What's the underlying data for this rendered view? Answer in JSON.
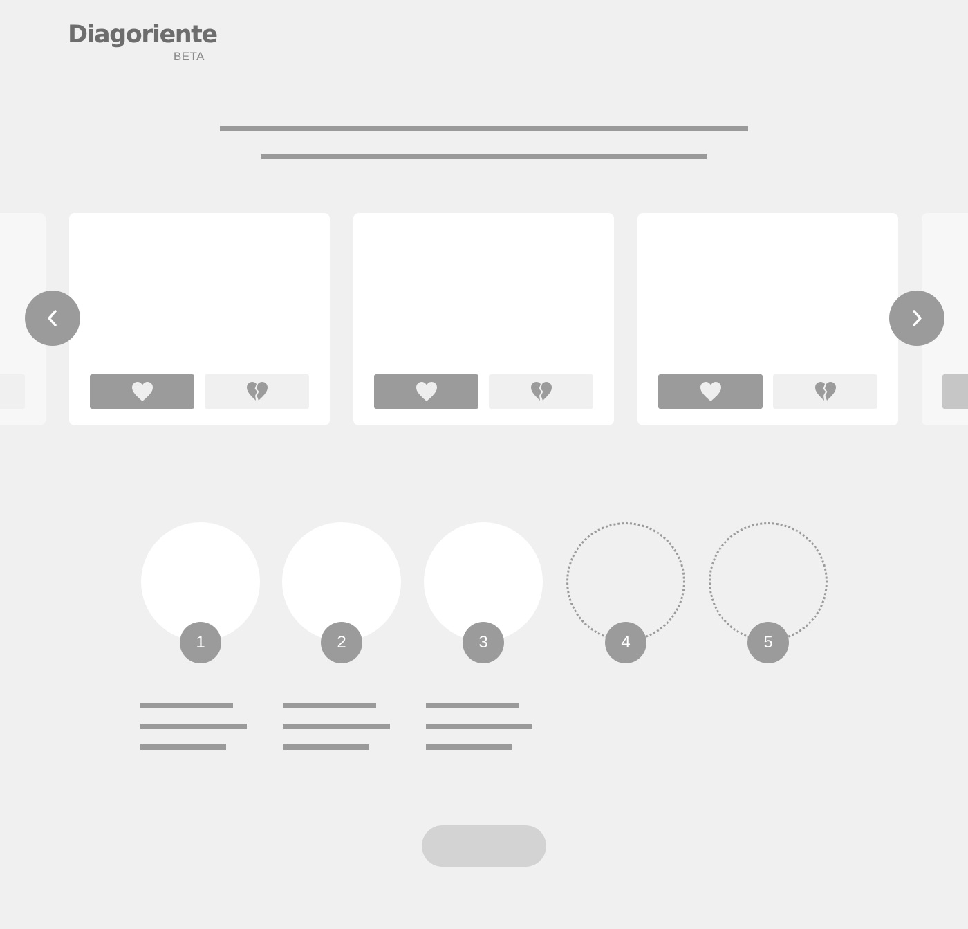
{
  "header": {
    "logo_text": "Diagoriente",
    "badge": "BETA"
  },
  "carousel": {
    "cards": [
      {
        "state": "partial-left",
        "like_icon": "heart-icon",
        "dislike_icon": "broken-heart-icon"
      },
      {
        "state": "visible",
        "like_icon": "heart-icon",
        "dislike_icon": "broken-heart-icon"
      },
      {
        "state": "visible",
        "like_icon": "heart-icon",
        "dislike_icon": "broken-heart-icon"
      },
      {
        "state": "visible",
        "like_icon": "heart-icon",
        "dislike_icon": "broken-heart-icon"
      },
      {
        "state": "partial-right",
        "like_icon": "heart-icon",
        "dislike_icon": "broken-heart-icon"
      }
    ],
    "prev_icon": "chevron-left-icon",
    "next_icon": "chevron-right-icon"
  },
  "steps": [
    {
      "number": "1",
      "filled": true
    },
    {
      "number": "2",
      "filled": true
    },
    {
      "number": "3",
      "filled": true
    },
    {
      "number": "4",
      "filled": false
    },
    {
      "number": "5",
      "filled": false
    }
  ],
  "colors": {
    "background": "#f0f0f0",
    "card": "#ffffff",
    "accent_gray": "#9b9b9b",
    "placeholder_line": "#9a9a9a",
    "pill": "#d3d3d3"
  }
}
